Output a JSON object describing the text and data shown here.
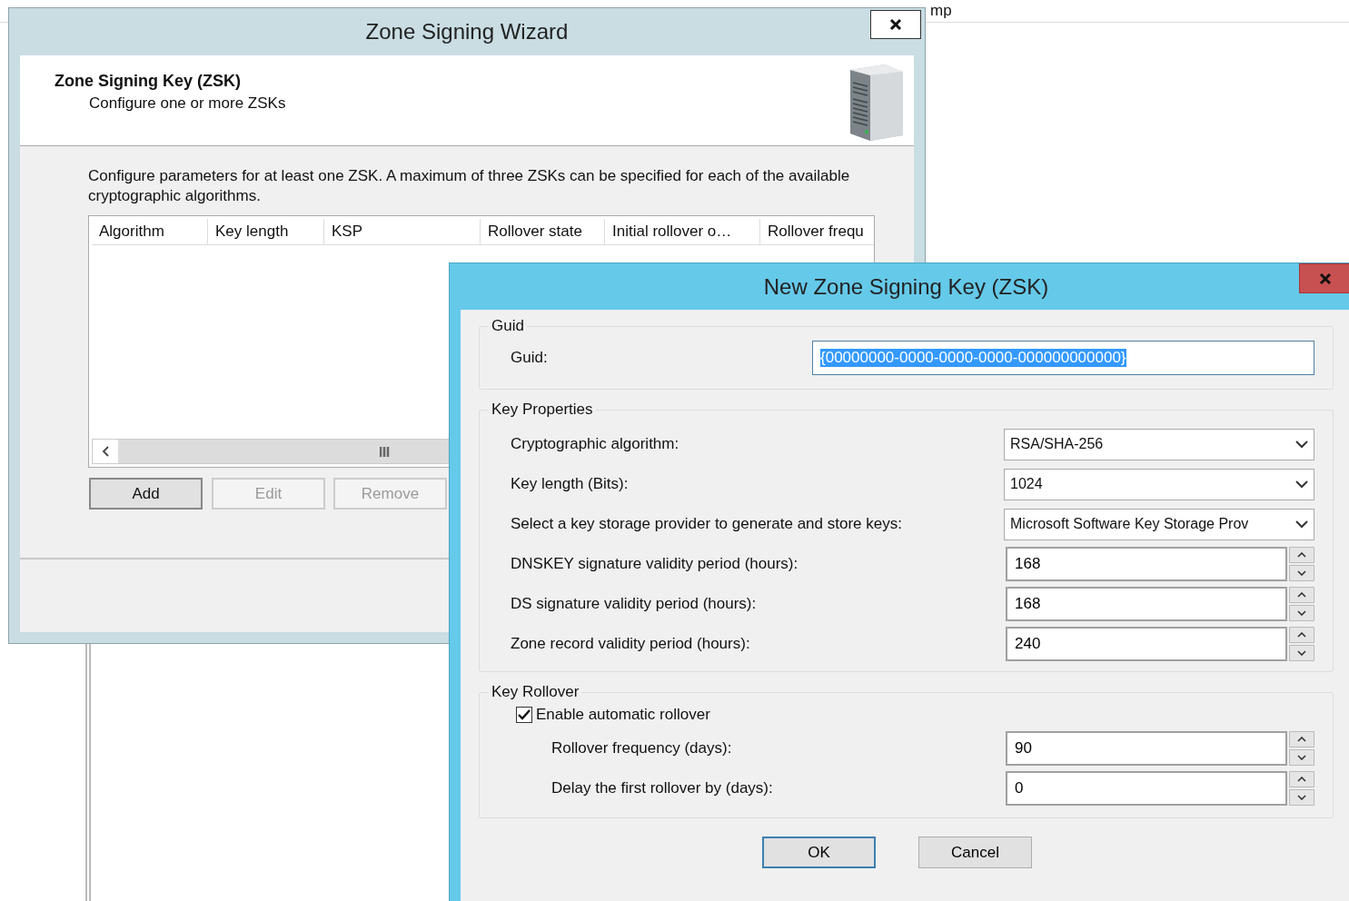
{
  "background_window": {
    "header_text": "mp"
  },
  "wizard": {
    "title": "Zone Signing Wizard",
    "header": {
      "title": "Zone Signing Key (ZSK)",
      "subtitle": "Configure one or more ZSKs"
    },
    "description": "Configure parameters for at least one ZSK. A maximum of three ZSKs can be specified for each of the available cryptographic algorithms.",
    "table": {
      "columns": [
        "Algorithm",
        "Key length",
        "KSP",
        "Rollover state",
        "Initial rollover o…",
        "Rollover frequ"
      ]
    },
    "buttons": [
      {
        "label": "Add",
        "disabled": false
      },
      {
        "label": "Edit",
        "disabled": true
      },
      {
        "label": "Remove",
        "disabled": true
      }
    ]
  },
  "dialog": {
    "title": "New Zone Signing Key (ZSK)",
    "guid_group": {
      "legend": "Guid",
      "label": "Guid:",
      "value": "{00000000-0000-0000-0000-000000000000}",
      "selected": true
    },
    "key_properties": {
      "legend": "Key Properties",
      "fields": [
        {
          "kind": "dropdown",
          "label": "Cryptographic algorithm:",
          "value": "RSA/SHA-256"
        },
        {
          "kind": "dropdown",
          "label": "Key length (Bits):",
          "value": "1024"
        },
        {
          "kind": "dropdown",
          "label": "Select a key storage provider to generate and store keys:",
          "value": "Microsoft Software Key Storage Prov"
        },
        {
          "kind": "spinner",
          "label": "DNSKEY signature validity period (hours):",
          "value": "168"
        },
        {
          "kind": "spinner",
          "label": "DS signature validity period (hours):",
          "value": "168"
        },
        {
          "kind": "spinner",
          "label": "Zone record validity period (hours):",
          "value": "240"
        }
      ]
    },
    "key_rollover": {
      "legend": "Key Rollover",
      "auto_rollover": {
        "label": "Enable automatic rollover",
        "checked": true
      },
      "fields": [
        {
          "kind": "spinner",
          "label": "Rollover frequency (days):",
          "value": "90"
        },
        {
          "kind": "spinner",
          "label": "Delay the first rollover by (days):",
          "value": "0"
        }
      ]
    },
    "buttons": [
      "OK",
      "Cancel"
    ]
  }
}
